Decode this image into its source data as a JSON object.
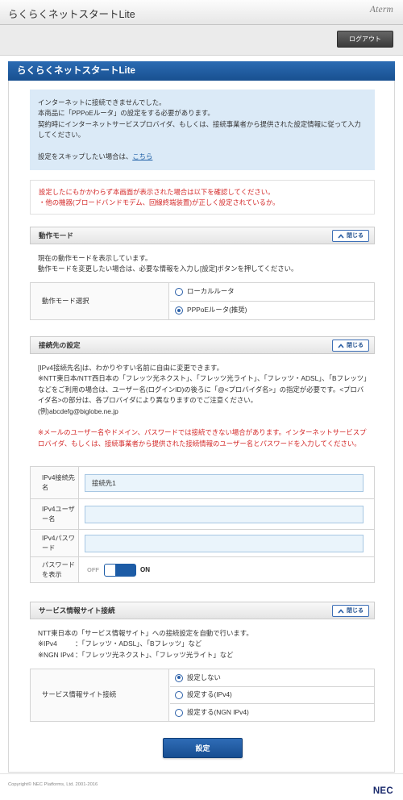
{
  "header": {
    "title": "らくらくネットスタートLite",
    "logo": "Aterm"
  },
  "toolbar": {
    "logout_label": "ログアウト"
  },
  "page_title": "らくらくネットスタートLite",
  "colors": {
    "brand_blue": "#1f5fa6",
    "warning_red": "#d42a2a",
    "notice_bg": "#dbeaf7"
  },
  "notice": {
    "lines": [
      "インターネットに接続できませんでした。",
      "本商品に「PPPoEルータ」の設定をする必要があります。",
      "契約時にインターネットサービスプロバイダ、もしくは、接続事業者から提供された設定情報に従って入力してください。"
    ],
    "skip_text": "設定をスキップしたい場合は、",
    "skip_link": "こちら"
  },
  "warning": {
    "lines": [
      "設定したにもかかわらず本画面が表示された場合は以下を確認してください。",
      "・他の機器(ブロードバンドモデム、回線終端装置)が正しく設定されているか。"
    ]
  },
  "mode": {
    "title": "動作モード",
    "close_label": "閉じる",
    "desc": [
      "現在の動作モードを表示しています。",
      "動作モードを変更したい場合は、必要な情報を入力し[設定]ボタンを押してください。"
    ],
    "field_label": "動作モード選択",
    "options": [
      {
        "label": "ローカルルータ",
        "checked": false
      },
      {
        "label": "PPPoEルータ(推奨)",
        "checked": true
      }
    ]
  },
  "connection": {
    "title": "接続先の設定",
    "close_label": "閉じる",
    "desc": [
      "[IPv4接続先名]は、わかりやすい名前に自由に変更できます。",
      "※NTT東日本/NTT西日本の「フレッツ光ネクスト」、「フレッツ光ライト」、「フレッツ・ADSL」、「Bフレッツ」などをご利用の場合は、ユーザー名(ログインID)の後ろに「@<プロバイダ名>」の指定が必要です。<プロバイダ名>の部分は、各プロバイダにより異なりますのでご注意ください。",
      "(例)abcdefg@biglobe.ne.jp"
    ],
    "caution": "※メールのユーザー名やドメイン、パスワードでは接続できない場合があります。インターネットサービスプロバイダ、もしくは、接続事業者から提供された接続情報のユーザー名とパスワードを入力してください。",
    "fields": [
      {
        "label": "IPv4接続先名",
        "value": "接続先1"
      },
      {
        "label": "IPv4ユーザー名",
        "value": ""
      },
      {
        "label": "IPv4パスワード",
        "value": ""
      }
    ],
    "show_password": {
      "label": "パスワードを表示",
      "off_label": "OFF",
      "on_label": "ON",
      "on": true
    }
  },
  "service": {
    "title": "サービス情報サイト接続",
    "close_label": "閉じる",
    "desc": "NTT東日本の「サービス情報サイト」への接続設定を自動で行います。",
    "notes": [
      {
        "prefix": "※IPv4",
        "text": "：「フレッツ・ADSL」、「Bフレッツ」など"
      },
      {
        "prefix": "※NGN IPv4",
        "text": "：「フレッツ光ネクスト」、「フレッツ光ライト」など"
      }
    ],
    "field_label": "サービス情報サイト接続",
    "options": [
      {
        "label": "設定しない",
        "checked": true
      },
      {
        "label": "設定する(IPv4)",
        "checked": false
      },
      {
        "label": "設定する(NGN IPv4)",
        "checked": false
      }
    ]
  },
  "submit_label": "設定",
  "footer": {
    "copyright": "Copyright© NEC Platforms, Ltd. 2001-2016",
    "logo": "NEC"
  }
}
